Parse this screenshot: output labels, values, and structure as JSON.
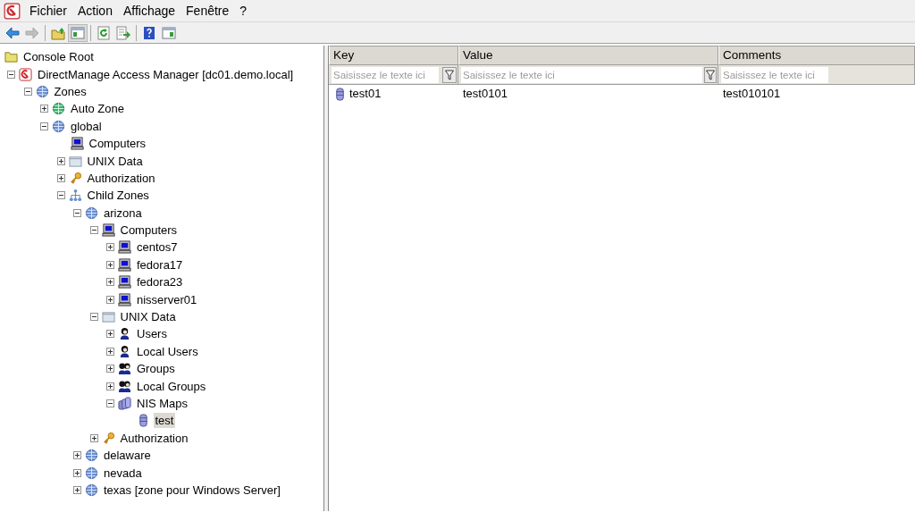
{
  "menu": [
    {
      "label": "Fichier"
    },
    {
      "label": "Action"
    },
    {
      "label": "Affichage"
    },
    {
      "label": "Fenêtre"
    },
    {
      "label": "?"
    }
  ],
  "toolbar": [
    {
      "kind": "back",
      "disabled": false,
      "pressed": false
    },
    {
      "kind": "forward",
      "disabled": true,
      "pressed": false
    },
    {
      "kind": "separator"
    },
    {
      "kind": "up",
      "disabled": false,
      "pressed": false
    },
    {
      "kind": "tree-toggle",
      "disabled": false,
      "pressed": true
    },
    {
      "kind": "separator"
    },
    {
      "kind": "refresh",
      "disabled": false,
      "pressed": false
    },
    {
      "kind": "export",
      "disabled": false,
      "pressed": false
    },
    {
      "kind": "separator"
    },
    {
      "kind": "help",
      "disabled": false,
      "pressed": false
    },
    {
      "kind": "pane-toggle",
      "disabled": false,
      "pressed": false
    }
  ],
  "tree": [
    {
      "label": "Console Root",
      "kind": "folder",
      "selected": false,
      "children": [
        {
          "label": "DirectManage Access Manager [dc01.demo.local]",
          "kind": "app",
          "expanded": true,
          "selected": false,
          "children": [
            {
              "label": "Zones",
              "kind": "globe",
              "expanded": true,
              "selected": false,
              "children": [
                {
                  "label": "Auto Zone",
                  "kind": "globe-green",
                  "expanded": false,
                  "selected": false
                },
                {
                  "label": "global",
                  "kind": "globe",
                  "expanded": true,
                  "selected": false,
                  "children": [
                    {
                      "label": "Computers",
                      "kind": "computer",
                      "selected": false
                    },
                    {
                      "label": "UNIX Data",
                      "kind": "unix-data",
                      "expanded": false,
                      "selected": false
                    },
                    {
                      "label": "Authorization",
                      "kind": "key",
                      "expanded": false,
                      "selected": false
                    },
                    {
                      "label": "Child Zones",
                      "kind": "hierarchy",
                      "expanded": true,
                      "selected": false,
                      "children": [
                        {
                          "label": "arizona",
                          "kind": "globe",
                          "expanded": true,
                          "selected": false,
                          "children": [
                            {
                              "label": "Computers",
                              "kind": "computer",
                              "expanded": true,
                              "selected": false,
                              "children": [
                                {
                                  "label": "centos7",
                                  "kind": "computer",
                                  "expanded": false,
                                  "selected": false
                                },
                                {
                                  "label": "fedora17",
                                  "kind": "computer",
                                  "expanded": false,
                                  "selected": false
                                },
                                {
                                  "label": "fedora23",
                                  "kind": "computer",
                                  "expanded": false,
                                  "selected": false
                                },
                                {
                                  "label": "nisserver01",
                                  "kind": "computer",
                                  "expanded": false,
                                  "selected": false
                                }
                              ]
                            },
                            {
                              "label": "UNIX Data",
                              "kind": "unix-data",
                              "expanded": true,
                              "selected": false,
                              "children": [
                                {
                                  "label": "Users",
                                  "kind": "user",
                                  "expanded": false,
                                  "selected": false
                                },
                                {
                                  "label": "Local Users",
                                  "kind": "user",
                                  "expanded": false,
                                  "selected": false
                                },
                                {
                                  "label": "Groups",
                                  "kind": "group",
                                  "expanded": false,
                                  "selected": false
                                },
                                {
                                  "label": "Local Groups",
                                  "kind": "group",
                                  "expanded": false,
                                  "selected": false
                                },
                                {
                                  "label": "NIS Maps",
                                  "kind": "db-stack",
                                  "expanded": true,
                                  "selected": false,
                                  "children": [
                                    {
                                      "label": "test",
                                      "kind": "db",
                                      "selected": true
                                    }
                                  ]
                                }
                              ]
                            },
                            {
                              "label": "Authorization",
                              "kind": "key",
                              "expanded": false,
                              "selected": false
                            }
                          ]
                        },
                        {
                          "label": "delaware",
                          "kind": "globe",
                          "expanded": false,
                          "selected": false
                        },
                        {
                          "label": "nevada",
                          "kind": "globe",
                          "expanded": false,
                          "selected": false
                        },
                        {
                          "label": "texas [zone pour Windows Server]",
                          "kind": "globe",
                          "expanded": false,
                          "selected": false
                        }
                      ]
                    }
                  ]
                }
              ]
            }
          ]
        }
      ]
    }
  ],
  "table": {
    "columns": [
      {
        "label": "Key",
        "placeholder": "Saisissez le texte ici",
        "filter": true
      },
      {
        "label": "Value",
        "placeholder": "Saisissez le texte ici",
        "filter": true
      },
      {
        "label": "Comments",
        "placeholder": "Saisissez le texte ici",
        "filter": false
      }
    ],
    "rows": [
      {
        "kind": "db",
        "cells": [
          "test01",
          "test0101",
          "test010101"
        ]
      }
    ]
  }
}
